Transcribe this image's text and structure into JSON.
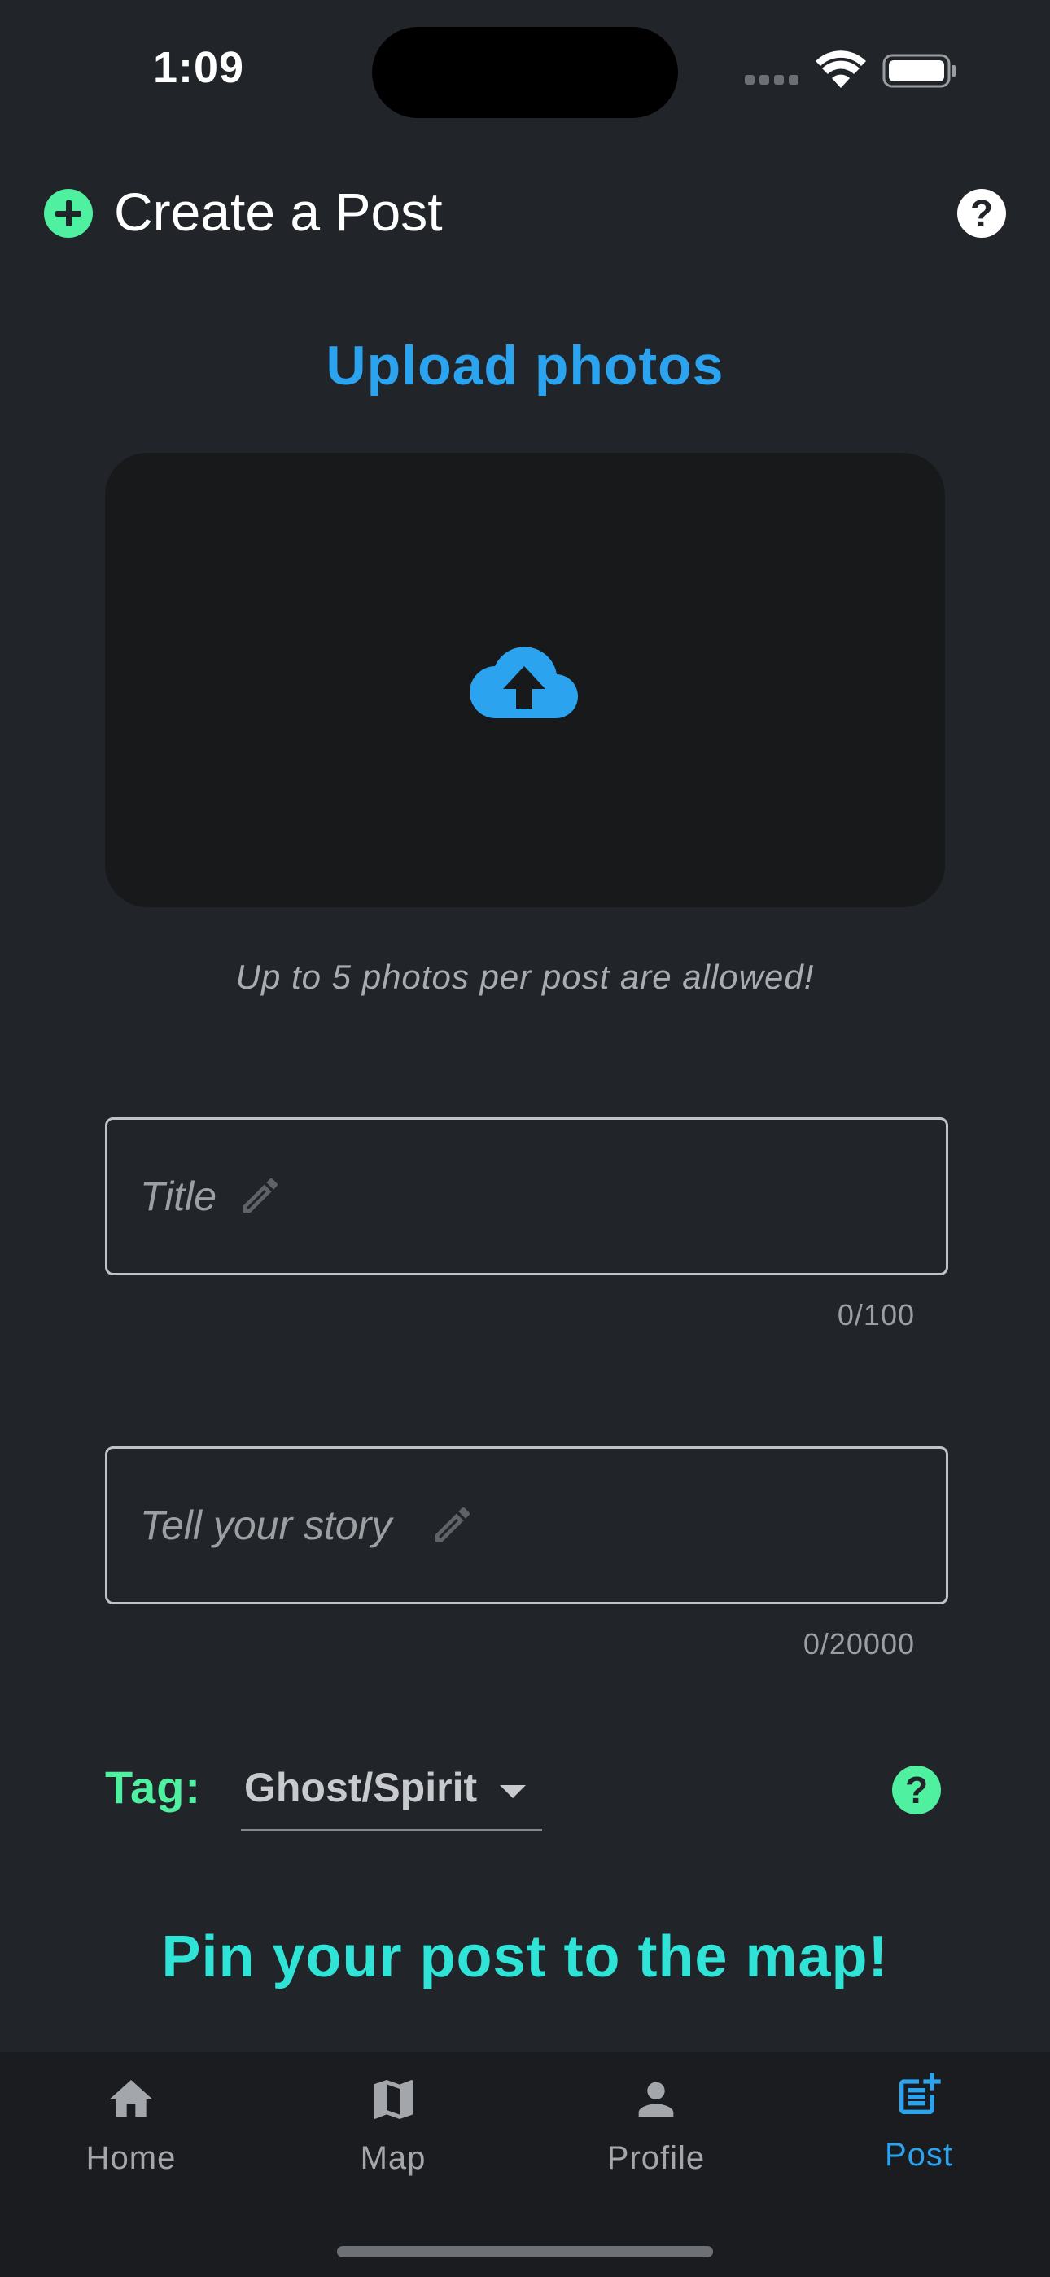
{
  "status_bar": {
    "time": "1:09"
  },
  "header": {
    "title": "Create a Post",
    "plus_icon": "plus-circle-icon",
    "help_icon": "help-circle-icon"
  },
  "upload": {
    "title": "Upload photos",
    "icon": "cloud-upload-icon",
    "hint": "Up to 5 photos per post are allowed!"
  },
  "title_field": {
    "placeholder": "Title",
    "value": "",
    "counter": "0/100"
  },
  "story_field": {
    "placeholder": "Tell your story",
    "value": "",
    "counter": "0/20000"
  },
  "tag": {
    "label": "Tag:",
    "selected": "Ghost/Spirit"
  },
  "pin_prompt": "Pin your post to the map!",
  "bottom_nav": {
    "items": [
      {
        "label": "Home",
        "icon": "home-icon"
      },
      {
        "label": "Map",
        "icon": "map-icon"
      },
      {
        "label": "Profile",
        "icon": "person-icon"
      },
      {
        "label": "Post",
        "icon": "post-add-icon"
      }
    ],
    "active": "Post"
  },
  "colors": {
    "background": "#212428",
    "accent_blue": "#2ba3ee",
    "accent_green": "#4ff0a0",
    "accent_teal": "#2fe3d6",
    "nav_background": "#1b1c1f"
  }
}
